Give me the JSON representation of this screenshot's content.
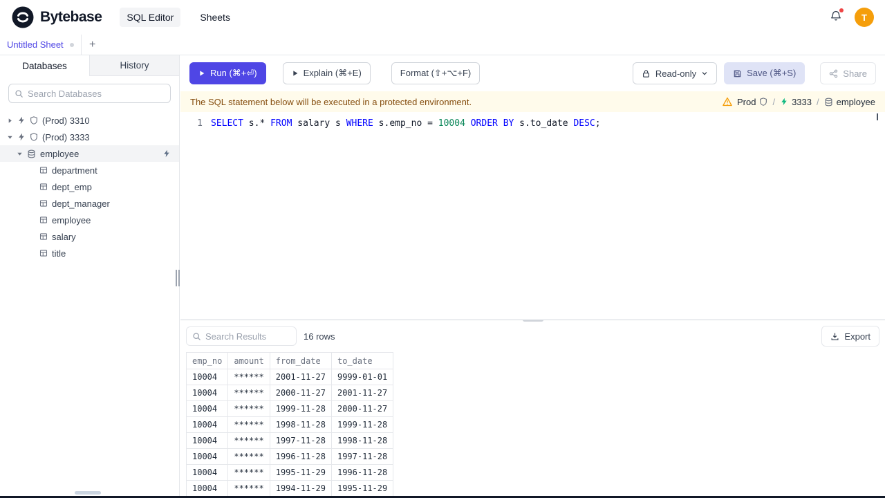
{
  "colors": {
    "primary": "#4f46e5",
    "keyword": "#0000ff",
    "number": "#098658",
    "warning-bg": "#fffbeb",
    "warning-text": "#854d0e",
    "avatar": "#f59e0b",
    "prod-warning": "#f59e0b",
    "connected-green": "#10b981"
  },
  "header": {
    "brand": "Bytebase",
    "nav": [
      {
        "label": "SQL Editor",
        "active": true
      },
      {
        "label": "Sheets",
        "active": false
      }
    ],
    "avatar_letter": "T"
  },
  "sheet_tabs": {
    "active_tab": "Untitled Sheet",
    "add_button": "+"
  },
  "sidebar": {
    "tabs": [
      {
        "label": "Databases",
        "active": true
      },
      {
        "label": "History",
        "active": false
      }
    ],
    "search_placeholder": "Search Databases",
    "tree": [
      {
        "kind": "instance",
        "caret": "collapsed",
        "icons": [
          "engine-icon",
          "shield-icon"
        ],
        "label": "(Prod) 3310"
      },
      {
        "kind": "instance",
        "caret": "expanded",
        "icons": [
          "engine-icon",
          "shield-icon"
        ],
        "label": "(Prod) 3333"
      },
      {
        "kind": "database",
        "caret": "expanded",
        "icons": [
          "database-icon"
        ],
        "label": "employee",
        "selected": true,
        "trailing_icon": "connect-icon"
      },
      {
        "kind": "table",
        "icons": [
          "table-icon"
        ],
        "label": "department"
      },
      {
        "kind": "table",
        "icons": [
          "table-icon"
        ],
        "label": "dept_emp"
      },
      {
        "kind": "table",
        "icons": [
          "table-icon"
        ],
        "label": "dept_manager"
      },
      {
        "kind": "table",
        "icons": [
          "table-icon"
        ],
        "label": "employee"
      },
      {
        "kind": "table",
        "icons": [
          "table-icon"
        ],
        "label": "salary"
      },
      {
        "kind": "table",
        "icons": [
          "table-icon"
        ],
        "label": "title"
      }
    ]
  },
  "toolbar": {
    "run": "Run (⌘+⏎)",
    "explain": "Explain (⌘+E)",
    "format": "Format (⇧+⌥+F)",
    "readonly": "Read-only",
    "save": "Save (⌘+S)",
    "share": "Share"
  },
  "banner": {
    "message": "The SQL statement below will be executed in a protected environment.",
    "environment": "Prod",
    "separator": "/",
    "instance": "3333",
    "database": "employee"
  },
  "editor": {
    "line_number": "1",
    "sql": "SELECT s.* FROM salary s WHERE s.emp_no = 10004 ORDER BY s.to_date DESC;",
    "tokens": [
      {
        "t": "SELECT",
        "c": "keyword"
      },
      {
        "t": " s.* ",
        "c": "plain"
      },
      {
        "t": "FROM",
        "c": "keyword"
      },
      {
        "t": " salary s ",
        "c": "plain"
      },
      {
        "t": "WHERE",
        "c": "keyword"
      },
      {
        "t": " s.emp_no = ",
        "c": "plain"
      },
      {
        "t": "10004",
        "c": "number"
      },
      {
        "t": " ",
        "c": "plain"
      },
      {
        "t": "ORDER BY",
        "c": "keyword"
      },
      {
        "t": " s.to_date ",
        "c": "plain"
      },
      {
        "t": "DESC",
        "c": "keyword"
      },
      {
        "t": ";",
        "c": "plain"
      }
    ]
  },
  "results": {
    "search_placeholder": "Search Results",
    "row_count": "16 rows",
    "export_label": "Export",
    "table": {
      "columns": [
        "emp_no",
        "amount",
        "from_date",
        "to_date"
      ],
      "rows": [
        [
          "10004",
          "******",
          "2001-11-27",
          "9999-01-01"
        ],
        [
          "10004",
          "******",
          "2000-11-27",
          "2001-11-27"
        ],
        [
          "10004",
          "******",
          "1999-11-28",
          "2000-11-27"
        ],
        [
          "10004",
          "******",
          "1998-11-28",
          "1999-11-28"
        ],
        [
          "10004",
          "******",
          "1997-11-28",
          "1998-11-28"
        ],
        [
          "10004",
          "******",
          "1996-11-28",
          "1997-11-28"
        ],
        [
          "10004",
          "******",
          "1995-11-29",
          "1996-11-28"
        ],
        [
          "10004",
          "******",
          "1994-11-29",
          "1995-11-29"
        ]
      ]
    }
  }
}
